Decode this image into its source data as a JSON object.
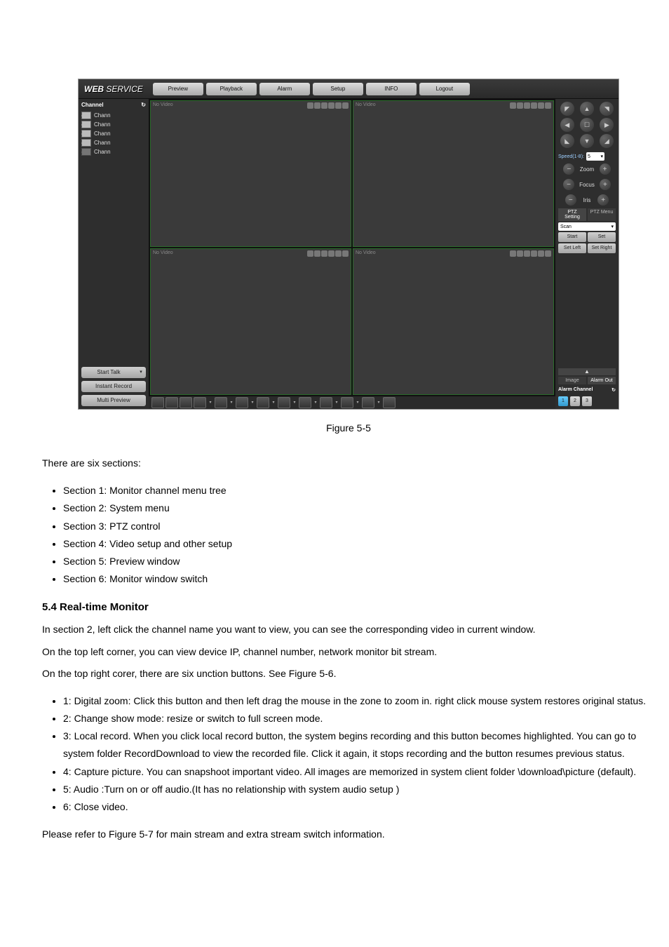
{
  "figure_caption": "Figure 5-5",
  "app": {
    "logo_bold": "WEB",
    "logo_light": " SERVICE",
    "tabs": [
      "Preview",
      "Playback",
      "Alarm",
      "Setup",
      "INFO",
      "Logout"
    ],
    "left": {
      "header": "Channel",
      "items": [
        "Chann",
        "Chann",
        "Chann",
        "Chann",
        "Chann"
      ],
      "start_talk": "Start Talk",
      "instant_record": "Instant Record",
      "multi_preview": "Multi Preview"
    },
    "panes": [
      "No Video",
      "No Video",
      "No Video",
      "No Video"
    ],
    "right": {
      "speed_label": "Speed(1-8):",
      "speed_value": "5",
      "zoom": "Zoom",
      "focus": "Focus",
      "iris": "Iris",
      "ptz_setting": "PTZ Setting",
      "ptz_menu": "PTZ Menu",
      "scan": "Scan",
      "start": "Start",
      "set": "Set",
      "set_left": "Set Left",
      "set_right": "Set Right",
      "image": "Image",
      "alarm_out": "Alarm Out",
      "alarm_channel": "Alarm Channel",
      "alarm_nums": [
        "1",
        "2",
        "3"
      ]
    }
  },
  "doc": {
    "line1": "There are six sections:",
    "s1": "Section 1: Monitor channel menu tree",
    "s2": "Section 2: System menu",
    "s3": "Section 3: PTZ control",
    "s4": "Section 4: Video setup and other setup",
    "s5": "Section 5: Preview window",
    "s6": "Section 6: Monitor window switch",
    "h_rt": "5.4 Real-time Monitor",
    "p_rt": "In section 2, left click the channel name you want to view, you can see the corresponding video in current window.",
    "p_rt2": "On the top left corner, you can view device IP, channel number, network monitor bit stream.",
    "p_rt3": "On the top right corer, there are six unction buttons. See Figure 5-6.",
    "li1": "1: Digital zoom: Click this button and then left drag the mouse in the zone to zoom in. right click mouse system restores original status.",
    "li2": "2: Change show mode: resize or switch to full screen mode.",
    "li3": "3: Local record. When you click local record button, the system begins recording and this button becomes highlighted. You can go to system folder RecordDownload to view the recorded file. Click it again, it stops recording and the button resumes previous status.",
    "li4": "4: Capture picture. You can snapshoot important video. All images are memorized in system client folder \\download\\picture (default).",
    "li5": "5: Audio :Turn on or off audio.(It has no relationship with system audio setup )",
    "li6": "6: Close video.",
    "p_refresh": "Please refer to Figure 5-7 for main stream and extra stream switch information."
  }
}
